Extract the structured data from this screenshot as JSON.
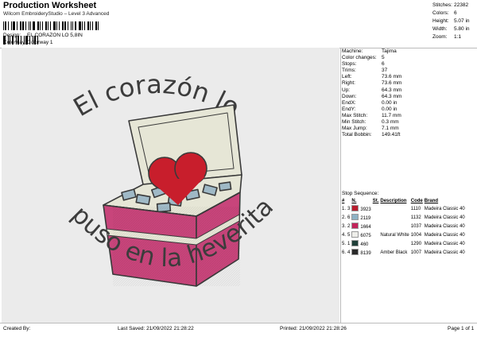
{
  "header": {
    "title": "Production Worksheet",
    "subtitle": "Wilcom EmbroideryStudio – Level 3 Advanced",
    "barcode_suffix": ","
  },
  "meta": [
    {
      "label": "Design:",
      "value": "EL CORAZON LO 5,8IN"
    },
    {
      "label": "Colorway:",
      "value": "Colorway 1"
    }
  ],
  "stats": [
    {
      "label": "Stitches:",
      "value": "22382"
    },
    {
      "label": "Colors:",
      "value": "6"
    },
    {
      "label": "Height:",
      "value": "5.07 in"
    },
    {
      "label": "Width:",
      "value": "5.80 in"
    },
    {
      "label": "Zoom:",
      "value": "1:1"
    }
  ],
  "design": {
    "text_top": "El corazón lo",
    "text_bottom": "puso en la heverita",
    "colors": {
      "text": "#3c3c3c",
      "cooler_pink": "#c8457b",
      "cooler_light": "#e6e6d6",
      "ice": "#9fb9c6",
      "heart": "#c81e2c",
      "outline": "#3a3a3a"
    }
  },
  "details": [
    {
      "label": "Machine:",
      "value": "Tajima"
    },
    {
      "label": "Color changes:",
      "value": "5"
    },
    {
      "label": "Stops:",
      "value": "6"
    },
    {
      "label": "Trims:",
      "value": "37"
    },
    {
      "label": "Left:",
      "value": "73.6 mm"
    },
    {
      "label": "Right:",
      "value": "73.6 mm"
    },
    {
      "label": "Up:",
      "value": "64.3 mm"
    },
    {
      "label": "Down:",
      "value": "64.3 mm"
    },
    {
      "label": "EndX:",
      "value": "0.00 in"
    },
    {
      "label": "EndY:",
      "value": "0.00 in"
    },
    {
      "label": "Max Stitch:",
      "value": "11.7 mm"
    },
    {
      "label": "Min Stitch:",
      "value": "0.3 mm"
    },
    {
      "label": "Max Jump:",
      "value": "7.1 mm"
    },
    {
      "label": "Total Bobbin:",
      "value": "149.41ft"
    }
  ],
  "stop_sequence": {
    "label": "Stop Sequence:",
    "headers": [
      "#",
      "",
      "N.",
      "St.",
      "Description",
      "Code",
      "Brand"
    ],
    "rows": [
      {
        "n": "1.",
        "num": "3",
        "color": "#b81d2e",
        "st": "3923",
        "desc": "",
        "code": "1110",
        "brand": "Madeira Classic 40"
      },
      {
        "n": "2.",
        "num": "6",
        "color": "#8fb2c4",
        "st": "2119",
        "desc": "",
        "code": "1132",
        "brand": "Madeira Classic 40"
      },
      {
        "n": "3.",
        "num": "2",
        "color": "#c2245a",
        "st": "1664",
        "desc": "",
        "code": "1037",
        "brand": "Madeira Classic 40"
      },
      {
        "n": "4.",
        "num": "5",
        "color": "#eeeeea",
        "st": "6075",
        "desc": "Natural White",
        "code": "1004",
        "brand": "Madeira Classic 40"
      },
      {
        "n": "5.",
        "num": "1",
        "color": "#1f3f38",
        "st": "460",
        "desc": "",
        "code": "1290",
        "brand": "Madeira Classic 40"
      },
      {
        "n": "6.",
        "num": "4",
        "color": "#2a2a2a",
        "st": "8139",
        "desc": "Amber Black",
        "code": "1007",
        "brand": "Madeira Classic 40"
      }
    ]
  },
  "footer": {
    "created_by": "Created By:",
    "last_saved": "Last Saved: 21/09/2022 21:28:22",
    "printed": "Printed: 21/09/2022 21:28:26",
    "page": "Page 1 of 1"
  }
}
